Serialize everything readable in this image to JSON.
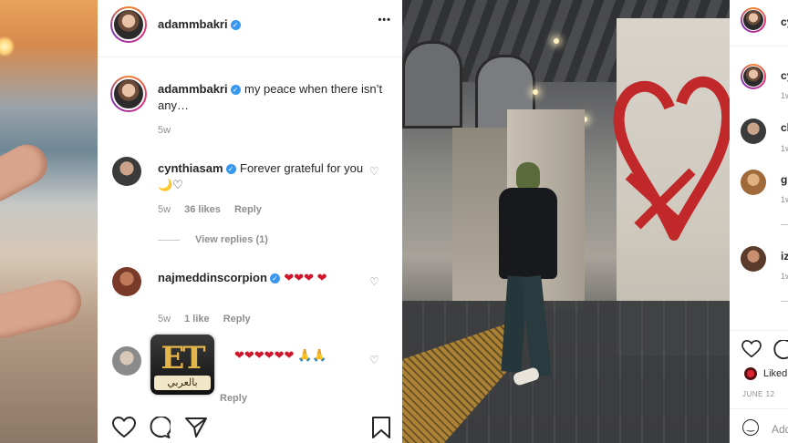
{
  "post": {
    "author": "adammbakri",
    "caption_user": "adammbakri",
    "caption_text": "my peace when there isn’t any…",
    "caption_age": "5w",
    "more_label": "•••"
  },
  "comments": [
    {
      "user": "cynthiasam",
      "text": "Forever grateful for you 🌙♡",
      "age": "5w",
      "likes": "36 likes",
      "reply": "Reply",
      "view_replies": "View replies (1)"
    },
    {
      "user": "najmeddinscorpion",
      "text": "❤❤❤ ❤",
      "age": "5w",
      "likes": "1 like",
      "reply": "Reply"
    },
    {
      "user": "",
      "text": "❤❤❤❤❤❤ 🙏🙏",
      "reply": "Reply"
    }
  ],
  "actions": {
    "like_icon": "heart-outline",
    "comment_icon": "speech-bubble",
    "share_icon": "paper-plane",
    "save_icon": "bookmark"
  },
  "right_panel": {
    "items": [
      {
        "name": "cy",
        "sub": ""
      },
      {
        "name": "cy",
        "sub": "1w"
      },
      {
        "name": "ch",
        "sub": "1w"
      },
      {
        "name": "gi",
        "sub": "1w"
      },
      {
        "name": "iz",
        "sub": "1w"
      }
    ],
    "liked_label": "Liked",
    "date": "JUNE 12",
    "add_comment": "Add"
  },
  "logo": {
    "main": "ET",
    "sub": "بالعربي"
  },
  "colors": {
    "verified": "#3897f0",
    "heart": "#ed4956",
    "muted": "#8e8e8e",
    "text": "#262626"
  }
}
